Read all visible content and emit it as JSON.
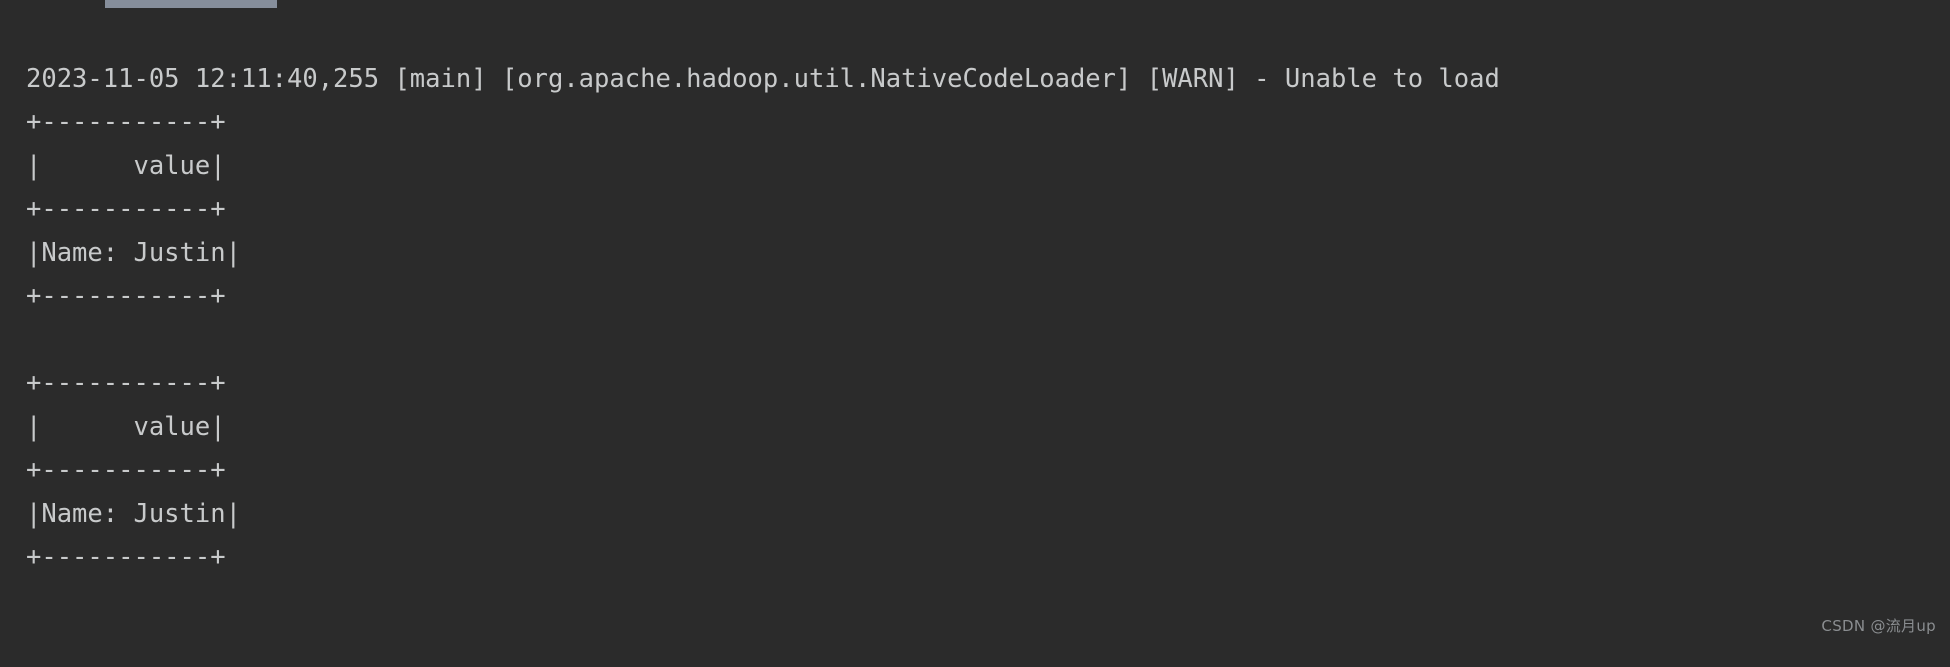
{
  "theme": {
    "background": "#2b2b2b",
    "foreground": "#c8cacb",
    "tab_fragment": "#868e9b",
    "watermark_color": "#8a8d90"
  },
  "console": {
    "log_line": "2023-11-05 12:11:40,255 [main] [org.apache.hadoop.util.NativeCodeLoader] [WARN] - Unable to load",
    "tables": [
      {
        "border": "+-----------+",
        "header": "|      value|",
        "row": "|Name: Justin|"
      },
      {
        "border": "+-----------+",
        "header": "|      value|",
        "row": "|Name: Justin|"
      }
    ]
  },
  "lines": {
    "l1": "2023-11-05 12:11:40,255 [main] [org.apache.hadoop.util.NativeCodeLoader] [WARN] - Unable to load",
    "l2": "+-----------+",
    "l3": "|      value|",
    "l4": "+-----------+",
    "l5": "|Name: Justin|",
    "l6": "+-----------+",
    "l7": "",
    "l8": "+-----------+",
    "l9": "|      value|",
    "l10": "+-----------+",
    "l11": "|Name: Justin|",
    "l12": "+-----------+"
  },
  "watermark": {
    "text": "CSDN @流月up"
  }
}
